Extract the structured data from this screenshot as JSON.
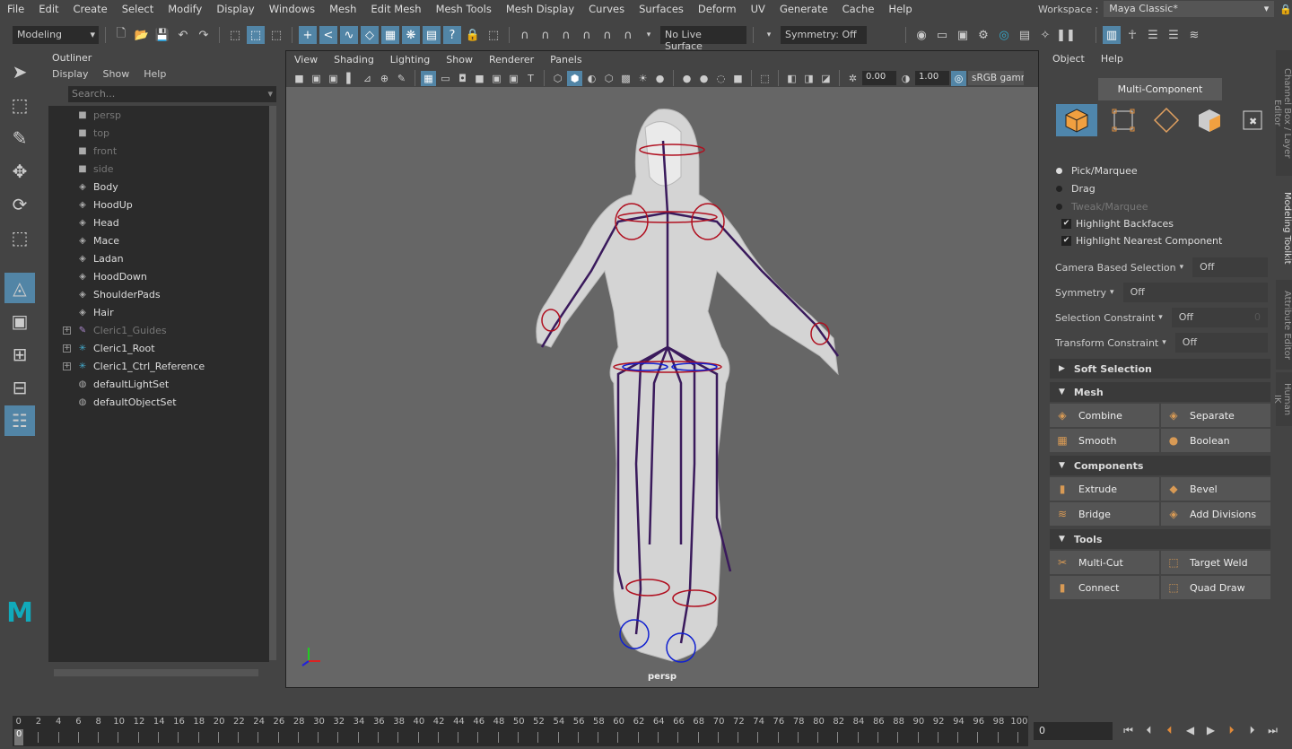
{
  "menubar": {
    "items": [
      "File",
      "Edit",
      "Create",
      "Select",
      "Modify",
      "Display",
      "Windows",
      "Mesh",
      "Edit Mesh",
      "Mesh Tools",
      "Mesh Display",
      "Curves",
      "Surfaces",
      "Deform",
      "UV",
      "Generate",
      "Cache",
      "Help"
    ],
    "workspace_label": "Workspace :",
    "workspace_value": "Maya Classic*"
  },
  "toolbar": {
    "menuset": "Modeling",
    "live_surface": "No Live Surface",
    "symmetry": "Symmetry: Off"
  },
  "outliner": {
    "title": "Outliner",
    "menu": [
      "Display",
      "Show",
      "Help"
    ],
    "search_placeholder": "Search...",
    "items": [
      {
        "label": "persp",
        "icon": "camera",
        "dim": true,
        "expand": false
      },
      {
        "label": "top",
        "icon": "camera",
        "dim": true,
        "expand": false
      },
      {
        "label": "front",
        "icon": "camera",
        "dim": true,
        "expand": false
      },
      {
        "label": "side",
        "icon": "camera",
        "dim": true,
        "expand": false
      },
      {
        "label": "Body",
        "icon": "mesh",
        "dim": false,
        "expand": false
      },
      {
        "label": "HoodUp",
        "icon": "mesh",
        "dim": false,
        "expand": false
      },
      {
        "label": "Head",
        "icon": "mesh",
        "dim": false,
        "expand": false
      },
      {
        "label": "Mace",
        "icon": "mesh",
        "dim": false,
        "expand": false
      },
      {
        "label": "Ladan",
        "icon": "mesh",
        "dim": false,
        "expand": false
      },
      {
        "label": "HoodDown",
        "icon": "mesh",
        "dim": false,
        "expand": false
      },
      {
        "label": "ShoulderPads",
        "icon": "mesh",
        "dim": false,
        "expand": false
      },
      {
        "label": "Hair",
        "icon": "mesh",
        "dim": false,
        "expand": false
      },
      {
        "label": "Cleric1_Guides",
        "icon": "joint",
        "dim": true,
        "expand": true
      },
      {
        "label": "Cleric1_Root",
        "icon": "locator",
        "dim": false,
        "expand": true
      },
      {
        "label": "Cleric1_Ctrl_Reference",
        "icon": "locator",
        "dim": false,
        "expand": true
      },
      {
        "label": "defaultLightSet",
        "icon": "set",
        "dim": false,
        "expand": false
      },
      {
        "label": "defaultObjectSet",
        "icon": "set",
        "dim": false,
        "expand": false
      }
    ]
  },
  "viewport": {
    "menu": [
      "View",
      "Shading",
      "Lighting",
      "Show",
      "Renderer",
      "Panels"
    ],
    "exposure": "0.00",
    "gamma": "1.00",
    "color_space": "sRGB gamm",
    "camera": "persp"
  },
  "toolkit": {
    "menu": [
      "Object",
      "Help"
    ],
    "mode": "Multi-Component",
    "radios": [
      {
        "label": "Pick/Marquee",
        "on": true
      },
      {
        "label": "Drag",
        "on": false
      },
      {
        "label": "Tweak/Marquee",
        "on": false
      }
    ],
    "checks": [
      "Highlight Backfaces",
      "Highlight Nearest Component"
    ],
    "options": [
      {
        "label": "Camera Based Selection",
        "value": "Off"
      },
      {
        "label": "Symmetry",
        "value": "Off"
      },
      {
        "label": "Selection Constraint",
        "value": "Off",
        "extra": "0"
      },
      {
        "label": "Transform Constraint",
        "value": "Off"
      }
    ],
    "soft_selection": "Soft Selection",
    "sections": [
      {
        "title": "Mesh",
        "buttons": [
          "Combine",
          "Separate",
          "Smooth",
          "Boolean"
        ]
      },
      {
        "title": "Components",
        "buttons": [
          "Extrude",
          "Bevel",
          "Bridge",
          "Add Divisions"
        ]
      },
      {
        "title": "Tools",
        "buttons": [
          "Multi-Cut",
          "Target Weld",
          "Connect",
          "Quad Draw"
        ]
      }
    ]
  },
  "side_tabs": [
    "Channel Box / Layer Editor",
    "Modeling Toolkit",
    "Attribute Editor",
    "Human IK"
  ],
  "timeline": {
    "start": 0,
    "end": 100,
    "step": 2,
    "current_frame": "0",
    "current_marker": "0"
  },
  "colors": {
    "accent": "#5285a6",
    "panel": "#444444",
    "field": "#2b2b2b",
    "viewport": "#666666",
    "skeleton": "#3a1a5c"
  }
}
